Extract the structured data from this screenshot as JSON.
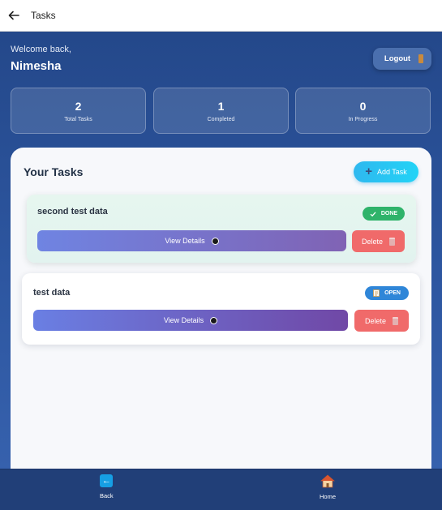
{
  "appbar": {
    "title": "Tasks",
    "back_icon": "arrow-left-icon"
  },
  "header": {
    "welcome": "Welcome back,",
    "username": "Nimesha",
    "logout_label": "Logout"
  },
  "stats": [
    {
      "value": "2",
      "label": "Total Tasks"
    },
    {
      "value": "1",
      "label": "Completed"
    },
    {
      "value": "0",
      "label": "In Progress"
    }
  ],
  "tasks_section": {
    "title": "Your Tasks",
    "add_label": "Add Task",
    "add_icon": "plus-icon"
  },
  "tasks": [
    {
      "title": "second test data",
      "status": "DONE",
      "status_icon": "check-icon",
      "status_color": "#2fb36a",
      "view_label": "View Details",
      "delete_label": "Delete"
    },
    {
      "title": "test data",
      "status": "OPEN",
      "status_icon": "memo-icon",
      "status_color": "#2f86d8",
      "view_label": "View Details",
      "delete_label": "Delete"
    }
  ],
  "bottom_nav": [
    {
      "label": "Back",
      "icon": "back-arrow-icon"
    },
    {
      "label": "Home",
      "icon": "house-icon"
    }
  ],
  "colors": {
    "background": "#2a4f93",
    "accent": "#22d3f6",
    "delete": "#f06a6a",
    "view_gradient_start": "#6a7fe3",
    "view_gradient_end": "#7a52ad"
  }
}
